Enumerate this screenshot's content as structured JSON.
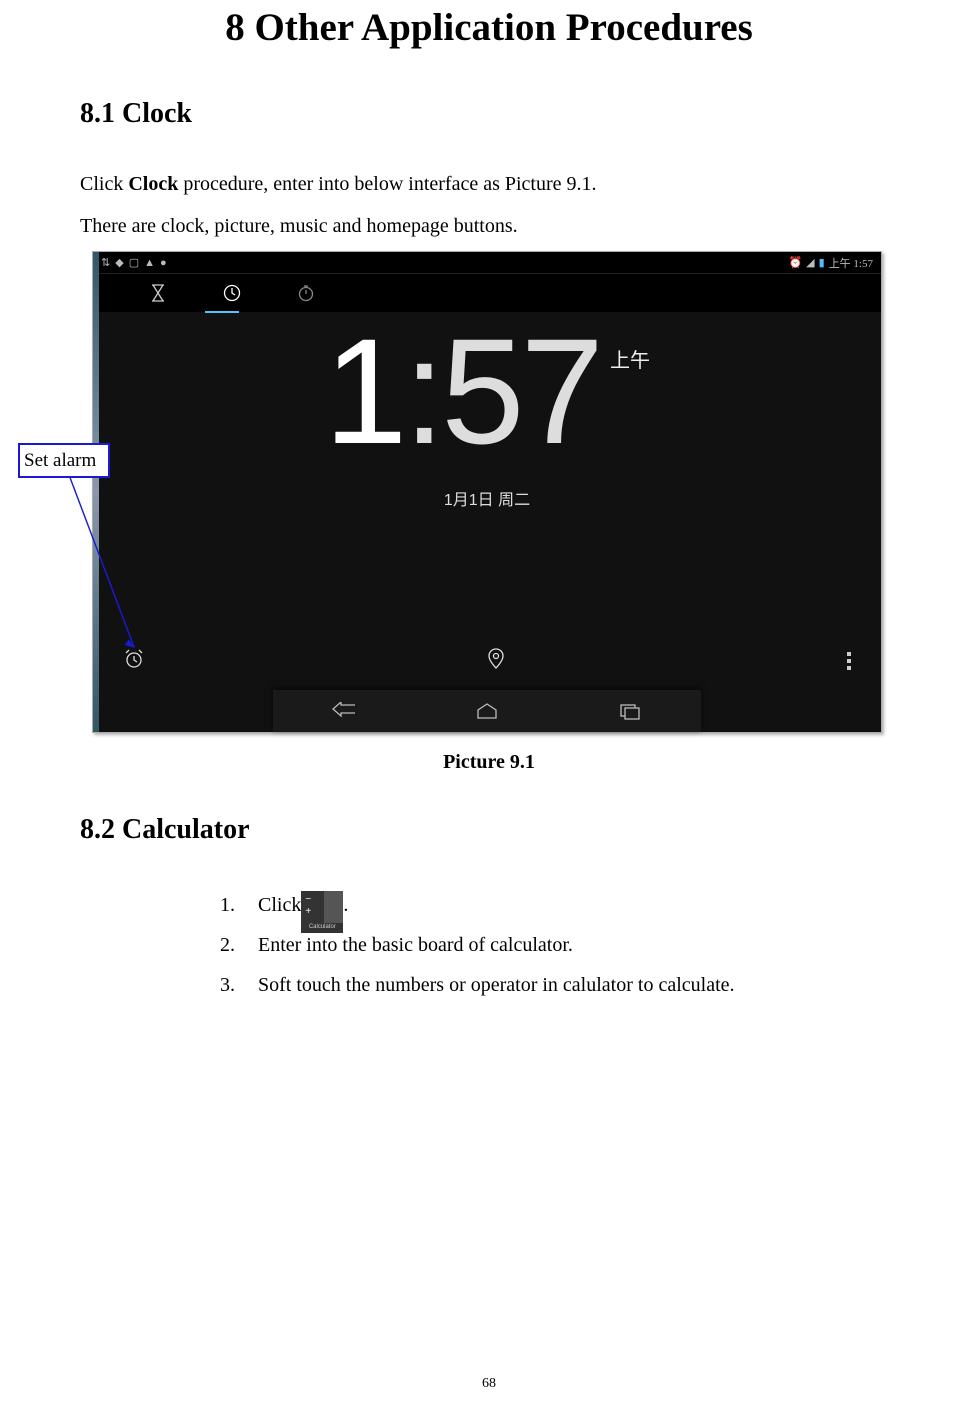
{
  "chapter_title": "8 Other Application Procedures",
  "section_8_1": {
    "heading": "8.1 Clock",
    "para1_prefix": "Click ",
    "para1_bold": "Clock",
    "para1_suffix": " procedure, enter into below interface as Picture 9.1.",
    "para2": "There are clock, picture, music and homepage buttons."
  },
  "callout_label": "Set alarm",
  "screenshot": {
    "status_time": "上午 1:57",
    "time_hour": "1",
    "time_colon": ":",
    "time_min": "57",
    "ampm": "上午",
    "date": "1月1日 周二"
  },
  "picture_caption": "Picture 9.1",
  "section_8_2": {
    "heading": "8.2 Calculator",
    "steps": [
      {
        "num": "1.",
        "pre": "Click",
        "post": ".",
        "icon_name": "calculator-icon",
        "icon_label": "Calculator"
      },
      {
        "num": "2.",
        "text": "Enter into the basic board of calculator."
      },
      {
        "num": "3.",
        "text": "Soft touch the numbers or operator in calulator to calculate."
      }
    ]
  },
  "page_number": "68",
  "calc_icon_symbols": {
    "minus": "−",
    "plus": "+",
    "equals": "="
  }
}
